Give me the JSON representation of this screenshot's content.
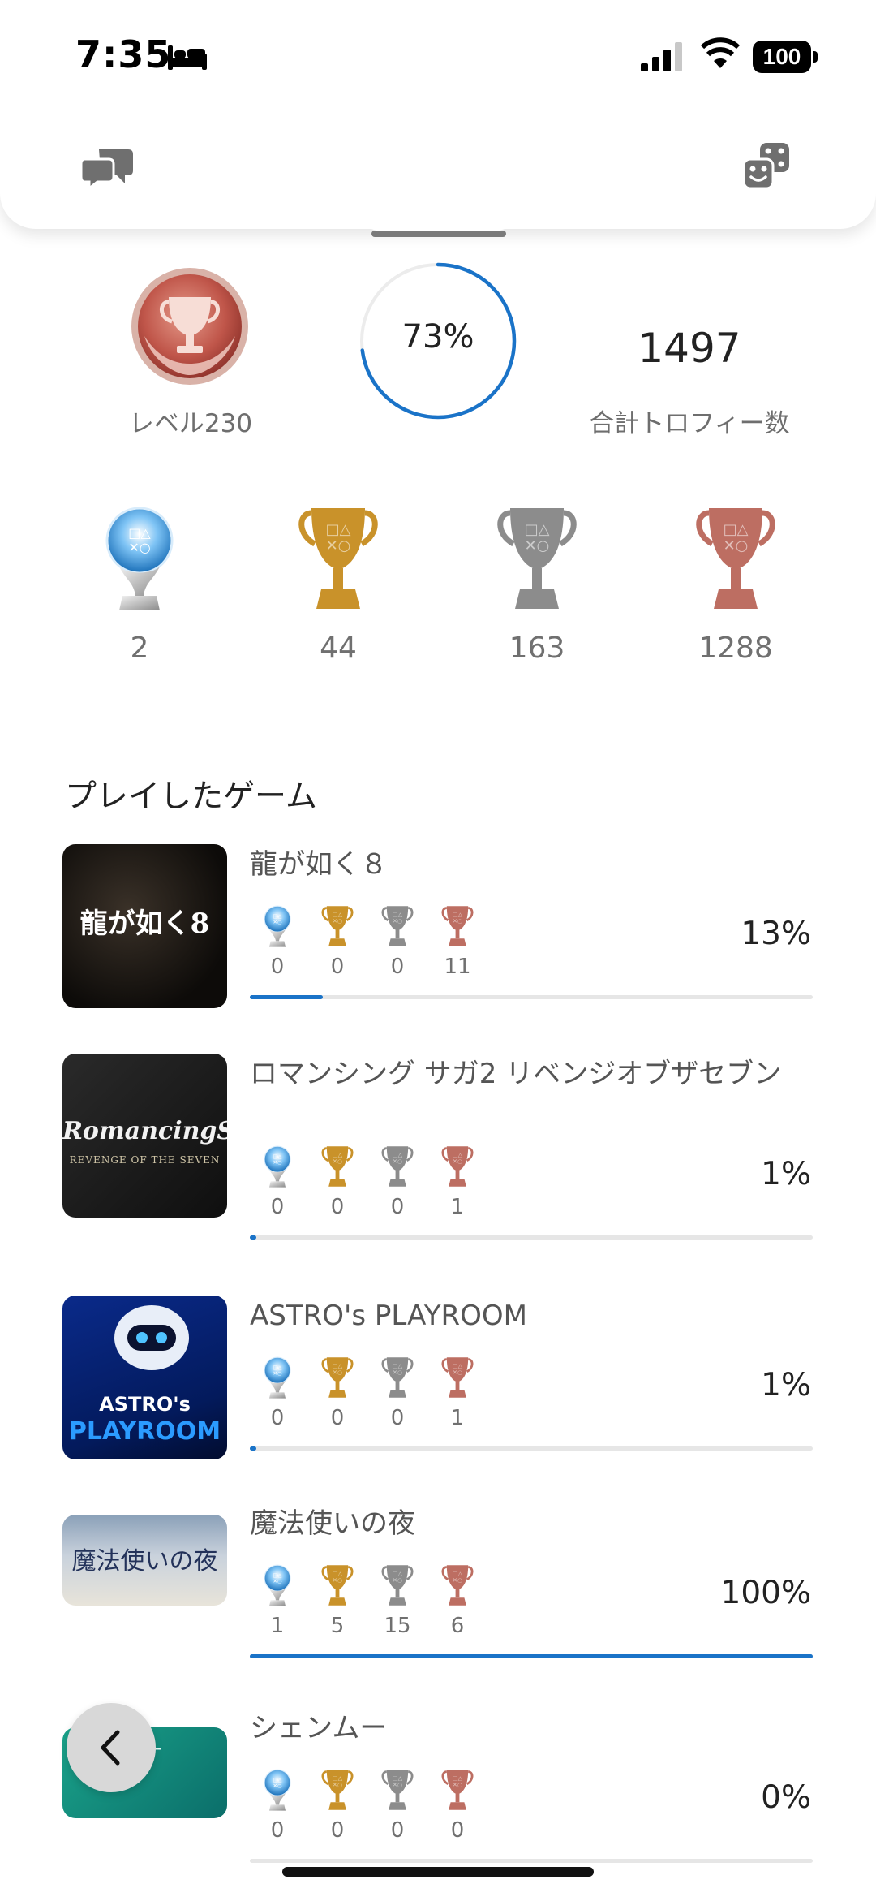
{
  "status_bar": {
    "time": "7:35",
    "battery": "100"
  },
  "summary": {
    "level_label": "レベル230",
    "progress_text": "73%",
    "progress": 0.73,
    "total_count": "1497",
    "total_label": "合計トロフィー数"
  },
  "trophy_counts": {
    "platinum": "2",
    "gold": "44",
    "silver": "163",
    "bronze": "1288"
  },
  "section_title": "プレイしたゲーム",
  "games": [
    {
      "title": "龍が如く８",
      "pct": "13%",
      "progress": 0.13,
      "platinum": "0",
      "gold": "0",
      "silver": "0",
      "bronze": "11",
      "thumb_text": "龍が如く8"
    },
    {
      "title": "ロマンシング サガ2 リベンジオブザセブン",
      "pct": "1%",
      "progress": 0.01,
      "platinum": "0",
      "gold": "0",
      "silver": "0",
      "bronze": "1",
      "thumb_text": "RomancingSaGa",
      "thumb_sub": "REVENGE OF THE SEVEN"
    },
    {
      "title": "ASTRO's PLAYROOM",
      "pct": "1%",
      "progress": 0.01,
      "platinum": "0",
      "gold": "0",
      "silver": "0",
      "bronze": "1",
      "thumb_text": "ASTRO's",
      "thumb_sub": "PLAYROOM"
    },
    {
      "title": "魔法使いの夜",
      "pct": "100%",
      "progress": 1.0,
      "platinum": "1",
      "gold": "5",
      "silver": "15",
      "bronze": "6",
      "thumb_text": "魔法使いの夜"
    },
    {
      "title": "シェンムー",
      "pct": "0%",
      "progress": 0.0,
      "platinum": "0",
      "gold": "0",
      "silver": "0",
      "bronze": "0",
      "thumb_text": "ムー"
    }
  ],
  "colors": {
    "accent": "#1a73c8",
    "gold": "#c58b1a",
    "silver": "#8a8a8a",
    "bronze": "#b9665a",
    "platinum": "#4aa3e8"
  },
  "icons": [
    "bed-icon",
    "signal-icon",
    "wifi-icon",
    "battery-icon",
    "chat-icon",
    "dice-icon",
    "level-badge-icon",
    "platinum-trophy-icon",
    "gold-trophy-icon",
    "silver-trophy-icon",
    "bronze-trophy-icon",
    "chevron-left-icon"
  ]
}
